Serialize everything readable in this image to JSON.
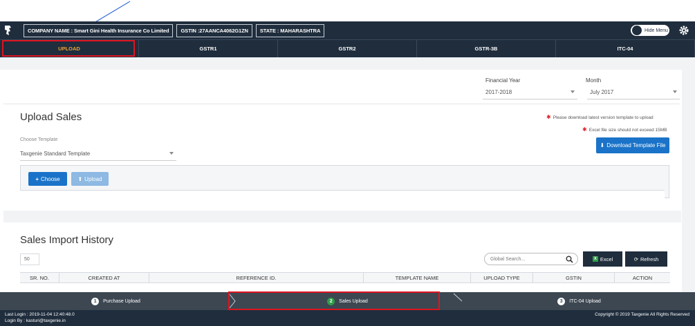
{
  "header": {
    "company": "COMPANY NAME : Smart Gini Health Insurance Co Limited",
    "gstin": "GSTIN :27AANCA4062G1ZN",
    "state": "STATE : MAHARASHTRA",
    "hide_menu": "Hide Menu"
  },
  "tabs": [
    "UPLOAD",
    "GSTR1",
    "GSTR2",
    "GSTR-3B",
    "ITC-04"
  ],
  "filters": {
    "fy_label": "Financial Year",
    "fy_value": "2017-2018",
    "month_label": "Month",
    "month_value": "July 2017"
  },
  "upload": {
    "title": "Upload Sales",
    "note1": "Please download latest version template to upload",
    "note2": "Excel file size should not exceed 15MB",
    "download_btn": "Download Template File",
    "choose_template_label": "Choose Template",
    "template_value": "Taxgenie Standard Template",
    "choose_btn": "Choose",
    "upload_btn": "Upload"
  },
  "history": {
    "title": "Sales Import History",
    "page_size": "50",
    "search_placeholder": "Global Search...",
    "excel_btn": "Excel",
    "refresh_btn": "Refresh",
    "columns": [
      "SR. NO.",
      "CREATED AT",
      "REFERENCE ID.",
      "TEMPLATE NAME",
      "UPLOAD TYPE",
      "GSTIN",
      "ACTION"
    ]
  },
  "steps": {
    "s1_num": "1",
    "s1_label": "Purchase Upload",
    "s2_num": "2",
    "s2_label": "Sales Upload",
    "s3_num": "3",
    "s3_label": "ITC-04 Upload"
  },
  "footer": {
    "last_login": "Last Login : 2019-11-04 12:40:48.0",
    "login_by": "Login By : kasturi@taxgenie.in",
    "copyright": "Copyright © 2019 Taxgenie All Rights Reserved"
  },
  "colors": {
    "nav_dark": "#1f2d3d",
    "active_tab": "#f0a030",
    "accent_blue": "#1a73c8",
    "highlight_red": "#e0141e",
    "step_green": "#2e9e48"
  }
}
